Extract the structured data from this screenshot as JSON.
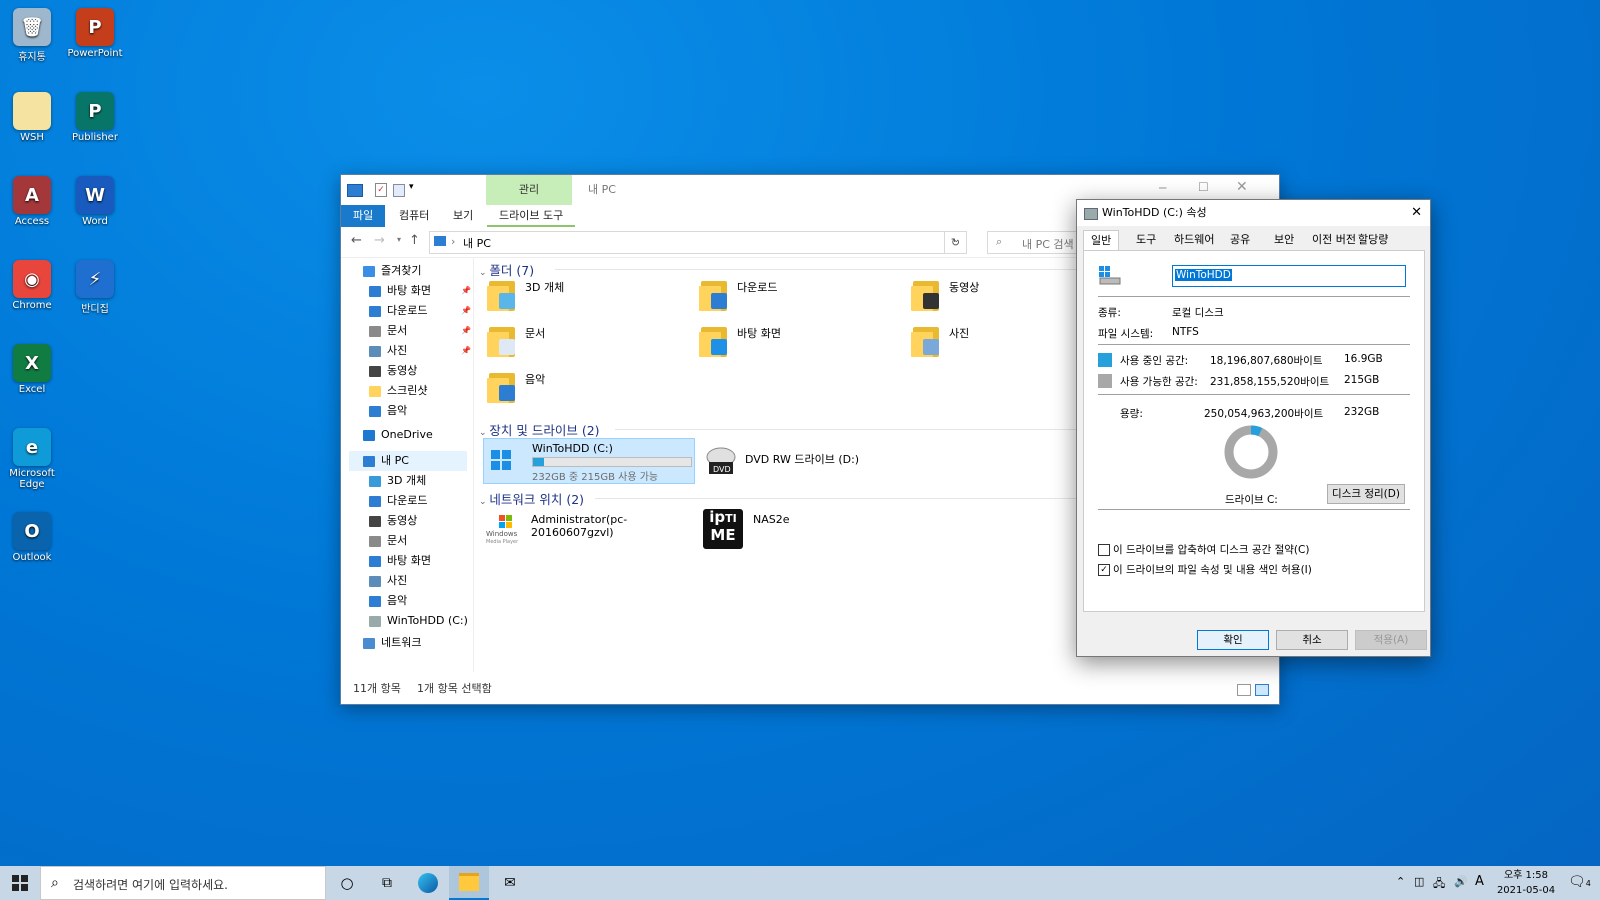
{
  "desktop": {
    "icons": [
      {
        "label": "휴지통",
        "glyph": "🗑",
        "color": "#9fb7cc",
        "name": "recycle-bin-icon"
      },
      {
        "label": "PowerPoint",
        "glyph": "P",
        "color": "#c43e1c",
        "name": "powerpoint-icon"
      },
      {
        "label": "WSH",
        "glyph": "",
        "color": "#f4e3a1",
        "name": "wsh-folder-icon"
      },
      {
        "label": "Publisher",
        "glyph": "P",
        "color": "#077568",
        "name": "publisher-icon"
      },
      {
        "label": "Access",
        "glyph": "A",
        "color": "#a4373a",
        "name": "access-icon"
      },
      {
        "label": "Word",
        "glyph": "W",
        "color": "#185abd",
        "name": "word-icon"
      },
      {
        "label": "Chrome",
        "glyph": "◉",
        "color": "#e8453c",
        "name": "chrome-icon"
      },
      {
        "label": "반디집",
        "glyph": "⚡",
        "color": "#1f6fd1",
        "name": "bandizip-icon"
      },
      {
        "label": "Excel",
        "glyph": "X",
        "color": "#107c41",
        "name": "excel-icon"
      },
      {
        "label": "Microsoft Edge",
        "glyph": "e",
        "color": "#0f9bd7",
        "name": "edge-icon"
      },
      {
        "label": "Outlook",
        "glyph": "O",
        "color": "#0a64ad",
        "name": "outlook-icon"
      }
    ]
  },
  "explorer": {
    "title": "내 PC",
    "manage_tab": "관리",
    "tabs": {
      "file": "파일",
      "computer": "컴퓨터",
      "view": "보기",
      "drive_tools": "드라이브 도구"
    },
    "address": "내 PC",
    "search_placeholder": "내 PC 검색",
    "nav": {
      "quick_access": "즐겨찾기",
      "quick_items": [
        "바탕 화면",
        "다운로드",
        "문서",
        "사진",
        "동영상",
        "스크린샷",
        "음악"
      ],
      "onedrive": "OneDrive",
      "this_pc": "내 PC",
      "pc_items": [
        "3D 개체",
        "다운로드",
        "동영상",
        "문서",
        "바탕 화면",
        "사진",
        "음악",
        "WinToHDD (C:)"
      ],
      "network": "네트워크"
    },
    "sections": {
      "folders": "폴더 (7)",
      "devices": "장치 및 드라이브 (2)",
      "network": "네트워크 위치 (2)"
    },
    "folders": [
      "3D 개체",
      "다운로드",
      "동영상",
      "문서",
      "바탕 화면",
      "사진",
      "음악"
    ],
    "drive_c": {
      "name": "WinToHDD (C:)",
      "free": "232GB 중 215GB 사용 가능",
      "used_fraction": 0.07
    },
    "drive_d": {
      "name": "DVD RW 드라이브 (D:)"
    },
    "net_locations": [
      "Administrator(pc-20160607gzvl)",
      "NAS2e"
    ],
    "status": {
      "count": "11개 항목",
      "selected": "1개 항목 선택함"
    }
  },
  "dialog": {
    "title": "WinToHDD (C:) 속성",
    "tabs": [
      "일반",
      "도구",
      "하드웨어",
      "공유",
      "보안",
      "이전 버전",
      "할당량"
    ],
    "name_value": "WinToHDD",
    "type_label": "종류:",
    "type_value": "로컬 디스크",
    "fs_label": "파일 시스템:",
    "fs_value": "NTFS",
    "used_label": "사용 중인 공간:",
    "used_bytes": "18,196,807,680바이트",
    "used_gb": "16.9GB",
    "free_label": "사용 가능한 공간:",
    "free_bytes": "231,858,155,520바이트",
    "free_gb": "215GB",
    "cap_label": "용량:",
    "cap_bytes": "250,054,963,200바이트",
    "cap_gb": "232GB",
    "drive_label": "드라이브 C:",
    "cleanup_button": "디스크 정리(D)",
    "compress_label": "이 드라이브를 압축하여 디스크 공간 절약(C)",
    "index_label": "이 드라이브의 파일 속성 및 내용 색인 허용(I)",
    "ok": "확인",
    "cancel": "취소",
    "apply": "적용(A)",
    "used_fraction": 0.07,
    "used_color": "#26a0da",
    "free_color": "#a8a8a8"
  },
  "taskbar": {
    "search_placeholder": "검색하려면 여기에 입력하세요.",
    "time": "오후 1:58",
    "date": "2021-05-04",
    "ime": "A",
    "notif_count": "4"
  }
}
